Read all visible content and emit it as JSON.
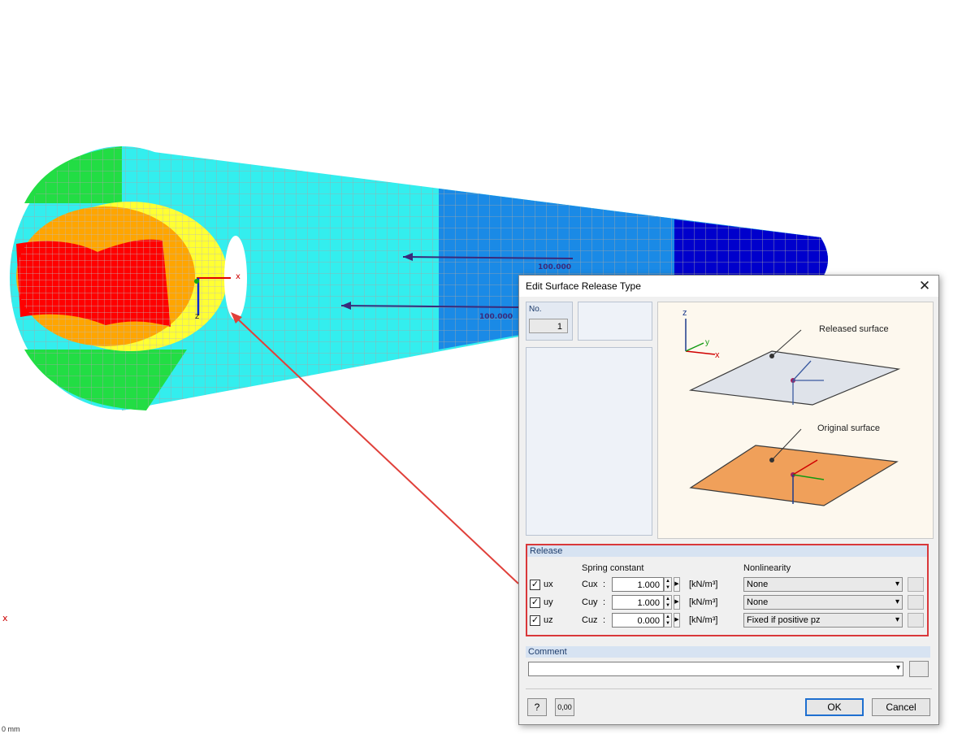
{
  "viewport": {
    "load_labels": [
      "100.000",
      "100.000"
    ],
    "axis_x": "x",
    "axis_z": "z",
    "corner_text": "0 mm",
    "colors": {
      "red": "#ff0000",
      "orange": "#ffa500",
      "yellow": "#ffff33",
      "green": "#22dd44",
      "cyan": "#33eeee",
      "blue": "#1a8ae6",
      "dark_blue": "#0000cc",
      "arrow": "#3a2a7a",
      "pointer": "#e0403a"
    }
  },
  "dialog": {
    "title": "Edit Surface Release Type",
    "close_icon": "close-icon",
    "no_label": "No.",
    "no_value": "1",
    "illustration": {
      "released_surface": "Released surface",
      "original_surface": "Original surface",
      "axis_z": "z",
      "axis_y": "y",
      "axis_x": "x"
    },
    "release": {
      "heading": "Release",
      "spring_constant_header": "Spring constant",
      "nonlinearity_header": "Nonlinearity",
      "rows": [
        {
          "checked": true,
          "dof": "ux",
          "constant_label": "Cux",
          "colon": ":",
          "value": "1.000",
          "unit": "[kN/m³]",
          "nonlinearity": "None"
        },
        {
          "checked": true,
          "dof": "uy",
          "constant_label": "Cuy",
          "colon": ":",
          "value": "1.000",
          "unit": "[kN/m³]",
          "nonlinearity": "None"
        },
        {
          "checked": true,
          "dof": "uz",
          "constant_label": "Cuz",
          "colon": ":",
          "value": "0.000",
          "unit": "[kN/m³]",
          "nonlinearity": "Fixed if positive pz"
        }
      ]
    },
    "comment": {
      "heading": "Comment",
      "value": ""
    },
    "buttons": {
      "ok": "OK",
      "cancel": "Cancel",
      "units_icon": "0,00"
    }
  }
}
